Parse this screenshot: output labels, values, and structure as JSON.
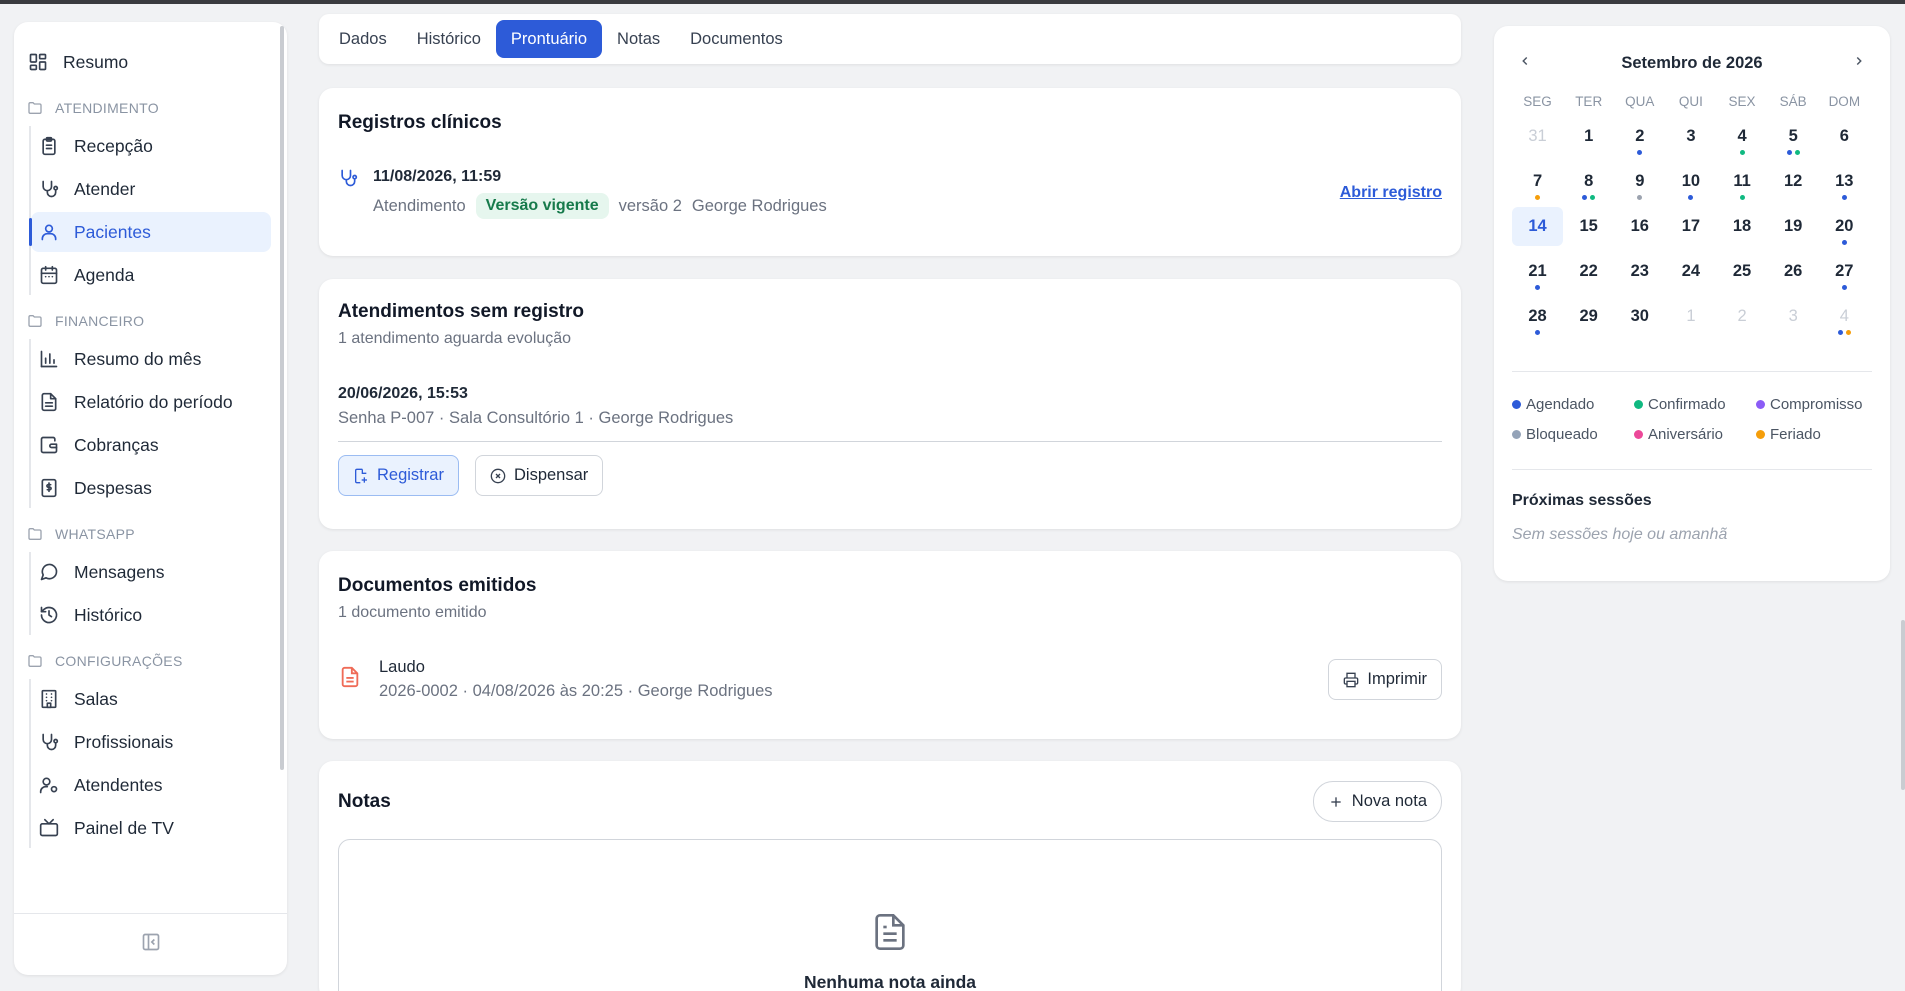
{
  "sidebar": {
    "resumo": "Resumo",
    "sections": [
      {
        "title": "ATENDIMENTO",
        "items": [
          {
            "label": "Recepção",
            "icon": "clipboard-icon"
          },
          {
            "label": "Atender",
            "icon": "stethoscope-icon"
          },
          {
            "label": "Pacientes",
            "icon": "user-icon",
            "active": true
          },
          {
            "label": "Agenda",
            "icon": "calendar-icon"
          }
        ]
      },
      {
        "title": "FINANCEIRO",
        "items": [
          {
            "label": "Resumo do mês",
            "icon": "bar-chart-icon"
          },
          {
            "label": "Relatório do período",
            "icon": "file-text-icon"
          },
          {
            "label": "Cobranças",
            "icon": "wallet-icon"
          },
          {
            "label": "Despesas",
            "icon": "receipt-icon"
          }
        ]
      },
      {
        "title": "WHATSAPP",
        "items": [
          {
            "label": "Mensagens",
            "icon": "message-circle-icon"
          },
          {
            "label": "Histórico",
            "icon": "history-icon"
          }
        ]
      },
      {
        "title": "CONFIGURAÇÕES",
        "items": [
          {
            "label": "Salas",
            "icon": "building-icon"
          },
          {
            "label": "Profissionais",
            "icon": "stethoscope-icon"
          },
          {
            "label": "Atendentes",
            "icon": "user-cog-icon"
          },
          {
            "label": "Painel de TV",
            "icon": "tv-icon"
          }
        ]
      }
    ]
  },
  "tabs": [
    "Dados",
    "Histórico",
    "Prontuário",
    "Notas",
    "Documentos"
  ],
  "active_tab": "Prontuário",
  "registros": {
    "title": "Registros clínicos",
    "date": "11/08/2026, 11:59",
    "type": "Atendimento",
    "badge": "Versão vigente",
    "version": "versão 2",
    "professional": "George Rodrigues",
    "link": "Abrir registro"
  },
  "sem_registro": {
    "title": "Atendimentos sem registro",
    "subtitle": "1 atendimento aguarda evolução",
    "date": "20/06/2026, 15:53",
    "desc": "Senha P-007 · Sala Consultório 1 · George Rodrigues",
    "btn_registrar": "Registrar",
    "btn_dispensar": "Dispensar"
  },
  "documentos": {
    "title": "Documentos emitidos",
    "subtitle": "1 documento emitido",
    "doc_title": "Laudo",
    "doc_meta": "2026-0002 · 04/08/2026 às 20:25 · George Rodrigues",
    "btn_imprimir": "Imprimir"
  },
  "notas": {
    "title": "Notas",
    "btn_nova": "Nova nota",
    "empty": "Nenhuma nota ainda"
  },
  "calendar": {
    "title": "Setembro de 2026",
    "weekdays": [
      "SEG",
      "TER",
      "QUA",
      "QUI",
      "SEX",
      "SÁB",
      "DOM"
    ],
    "weeks": [
      [
        {
          "d": "31",
          "muted": true
        },
        {
          "d": "1"
        },
        {
          "d": "2",
          "dots": [
            "#2d5bd8"
          ]
        },
        {
          "d": "3"
        },
        {
          "d": "4",
          "dots": [
            "#10b981"
          ]
        },
        {
          "d": "5",
          "dots": [
            "#2d5bd8",
            "#10b981"
          ]
        },
        {
          "d": "6"
        }
      ],
      [
        {
          "d": "7",
          "dots": [
            "#f59e0b"
          ]
        },
        {
          "d": "8",
          "dots": [
            "#2d5bd8",
            "#10b981"
          ]
        },
        {
          "d": "9",
          "dots": [
            "#9ca3af"
          ]
        },
        {
          "d": "10",
          "dots": [
            "#2d5bd8"
          ]
        },
        {
          "d": "11",
          "dots": [
            "#10b981"
          ]
        },
        {
          "d": "12"
        },
        {
          "d": "13",
          "dots": [
            "#2d5bd8"
          ]
        }
      ],
      [
        {
          "d": "14",
          "today": true
        },
        {
          "d": "15"
        },
        {
          "d": "16"
        },
        {
          "d": "17"
        },
        {
          "d": "18"
        },
        {
          "d": "19"
        },
        {
          "d": "20",
          "dots": [
            "#2d5bd8"
          ]
        }
      ],
      [
        {
          "d": "21",
          "dots": [
            "#2d5bd8"
          ]
        },
        {
          "d": "22"
        },
        {
          "d": "23"
        },
        {
          "d": "24"
        },
        {
          "d": "25"
        },
        {
          "d": "26"
        },
        {
          "d": "27",
          "dots": [
            "#2d5bd8"
          ]
        }
      ],
      [
        {
          "d": "28",
          "dots": [
            "#2d5bd8"
          ]
        },
        {
          "d": "29"
        },
        {
          "d": "30"
        },
        {
          "d": "1",
          "muted": true
        },
        {
          "d": "2",
          "muted": true
        },
        {
          "d": "3",
          "muted": true
        },
        {
          "d": "4",
          "muted": true,
          "dots": [
            "#2d5bd8",
            "#f59e0b"
          ]
        }
      ]
    ],
    "legend": [
      {
        "label": "Agendado",
        "color": "#2d5bd8"
      },
      {
        "label": "Confirmado",
        "color": "#10b981"
      },
      {
        "label": "Compromisso",
        "color": "#8b5cf6"
      },
      {
        "label": "Bloqueado",
        "color": "#94a3b8"
      },
      {
        "label": "Aniversário",
        "color": "#ec4899"
      },
      {
        "label": "Feriado",
        "color": "#f59e0b"
      }
    ],
    "next_title": "Próximas sessões",
    "next_empty": "Sem sessões hoje ou amanhã"
  }
}
